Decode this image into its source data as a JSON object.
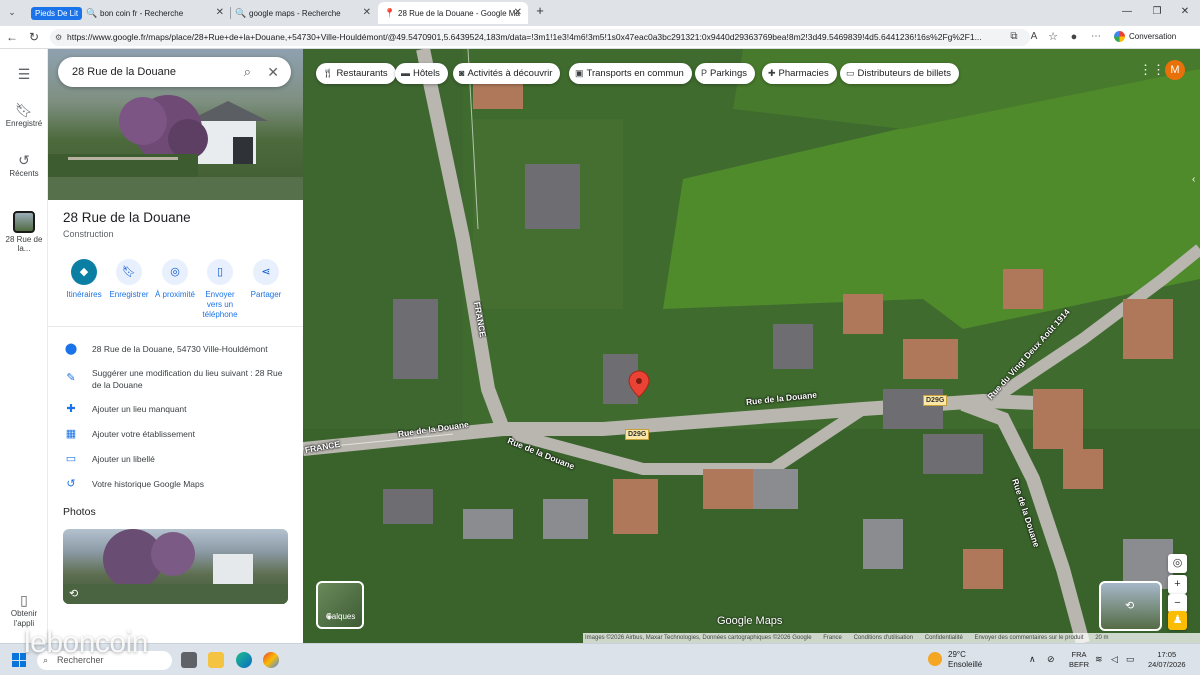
{
  "browser": {
    "tab_group": "Pieds De Lit",
    "tabs": [
      {
        "label": "bon coin fr - Recherche"
      },
      {
        "label": "google maps - Recherche"
      },
      {
        "label": "28 Rue de la Douane - Google Ma"
      }
    ],
    "url": "https://www.google.fr/maps/place/28+Rue+de+la+Douane,+54730+Ville-Houldémont/@49.5470901,5.6439524,183m/data=!3m1!1e3!4m6!3m5!1s0x47eac0a3bc291321:0x9440d29363769bea!8m2!3d49.5469839!4d5.6441236!16s%2Fg%2F1...",
    "conversation_label": "Conversation"
  },
  "rail": {
    "saved": "Enregistré",
    "recent": "Récents",
    "recent_place": "28 Rue de la...",
    "get_app": "Obtenir l'appli"
  },
  "panel": {
    "search_value": "28 Rue de la Douane",
    "title": "28 Rue de la Douane",
    "category": "Construction",
    "actions": [
      {
        "label": "Itinéraires"
      },
      {
        "label": "Enregistrer"
      },
      {
        "label": "À proximité"
      },
      {
        "label": "Envoyer vers un téléphone"
      },
      {
        "label": "Partager"
      }
    ],
    "info": [
      {
        "text": "28 Rue de la Douane, 54730 Ville-Houldémont"
      },
      {
        "text": "Suggérer une modification du lieu suivant : 28 Rue de la Douane"
      },
      {
        "text": "Ajouter un lieu manquant"
      },
      {
        "text": "Ajouter votre établissement"
      },
      {
        "text": "Ajouter un libellé"
      },
      {
        "text": "Votre historique Google Maps"
      }
    ],
    "photos_heading": "Photos"
  },
  "map": {
    "chips": [
      {
        "label": "Restaurants"
      },
      {
        "label": "Hôtels"
      },
      {
        "label": "Activités à découvrir"
      },
      {
        "label": "Transports en commun"
      },
      {
        "label": "Parkings"
      },
      {
        "label": "Pharmacies"
      },
      {
        "label": "Distributeurs de billets"
      }
    ],
    "avatar_letter": "M",
    "layers_label": "Calques",
    "logo": "Google Maps",
    "road_labels": {
      "rue_douane_1": "Rue de la Douane",
      "rue_douane_2": "Rue de la Douane",
      "rue_douane_3": "Rue de la Douane",
      "rue_douane_4": "Rue de la Douane",
      "france_1": "FRANCE",
      "france_2": "FRANCE",
      "vingt_deux": "Rue du Vingt Deux Août 1914",
      "d29g_1": "D29G",
      "d29g_2": "D29G"
    },
    "attribution": [
      {
        "text": "Images ©2026 Airbus, Maxar Technologies, Données cartographiques ©2026 Google"
      },
      {
        "text": "France"
      },
      {
        "text": "Conditions d'utilisation"
      },
      {
        "text": "Confidentialité"
      },
      {
        "text": "Envoyer des commentaires sur le produit"
      },
      {
        "text": "20 m"
      }
    ]
  },
  "taskbar": {
    "search_placeholder": "Rechercher",
    "watermark": "leboncoin",
    "weather_temp": "29°C",
    "weather_desc": "Ensoleillé",
    "lang_1": "FRA",
    "lang_2": "BEFR",
    "time": "17:05",
    "date": "24/07/2026"
  }
}
